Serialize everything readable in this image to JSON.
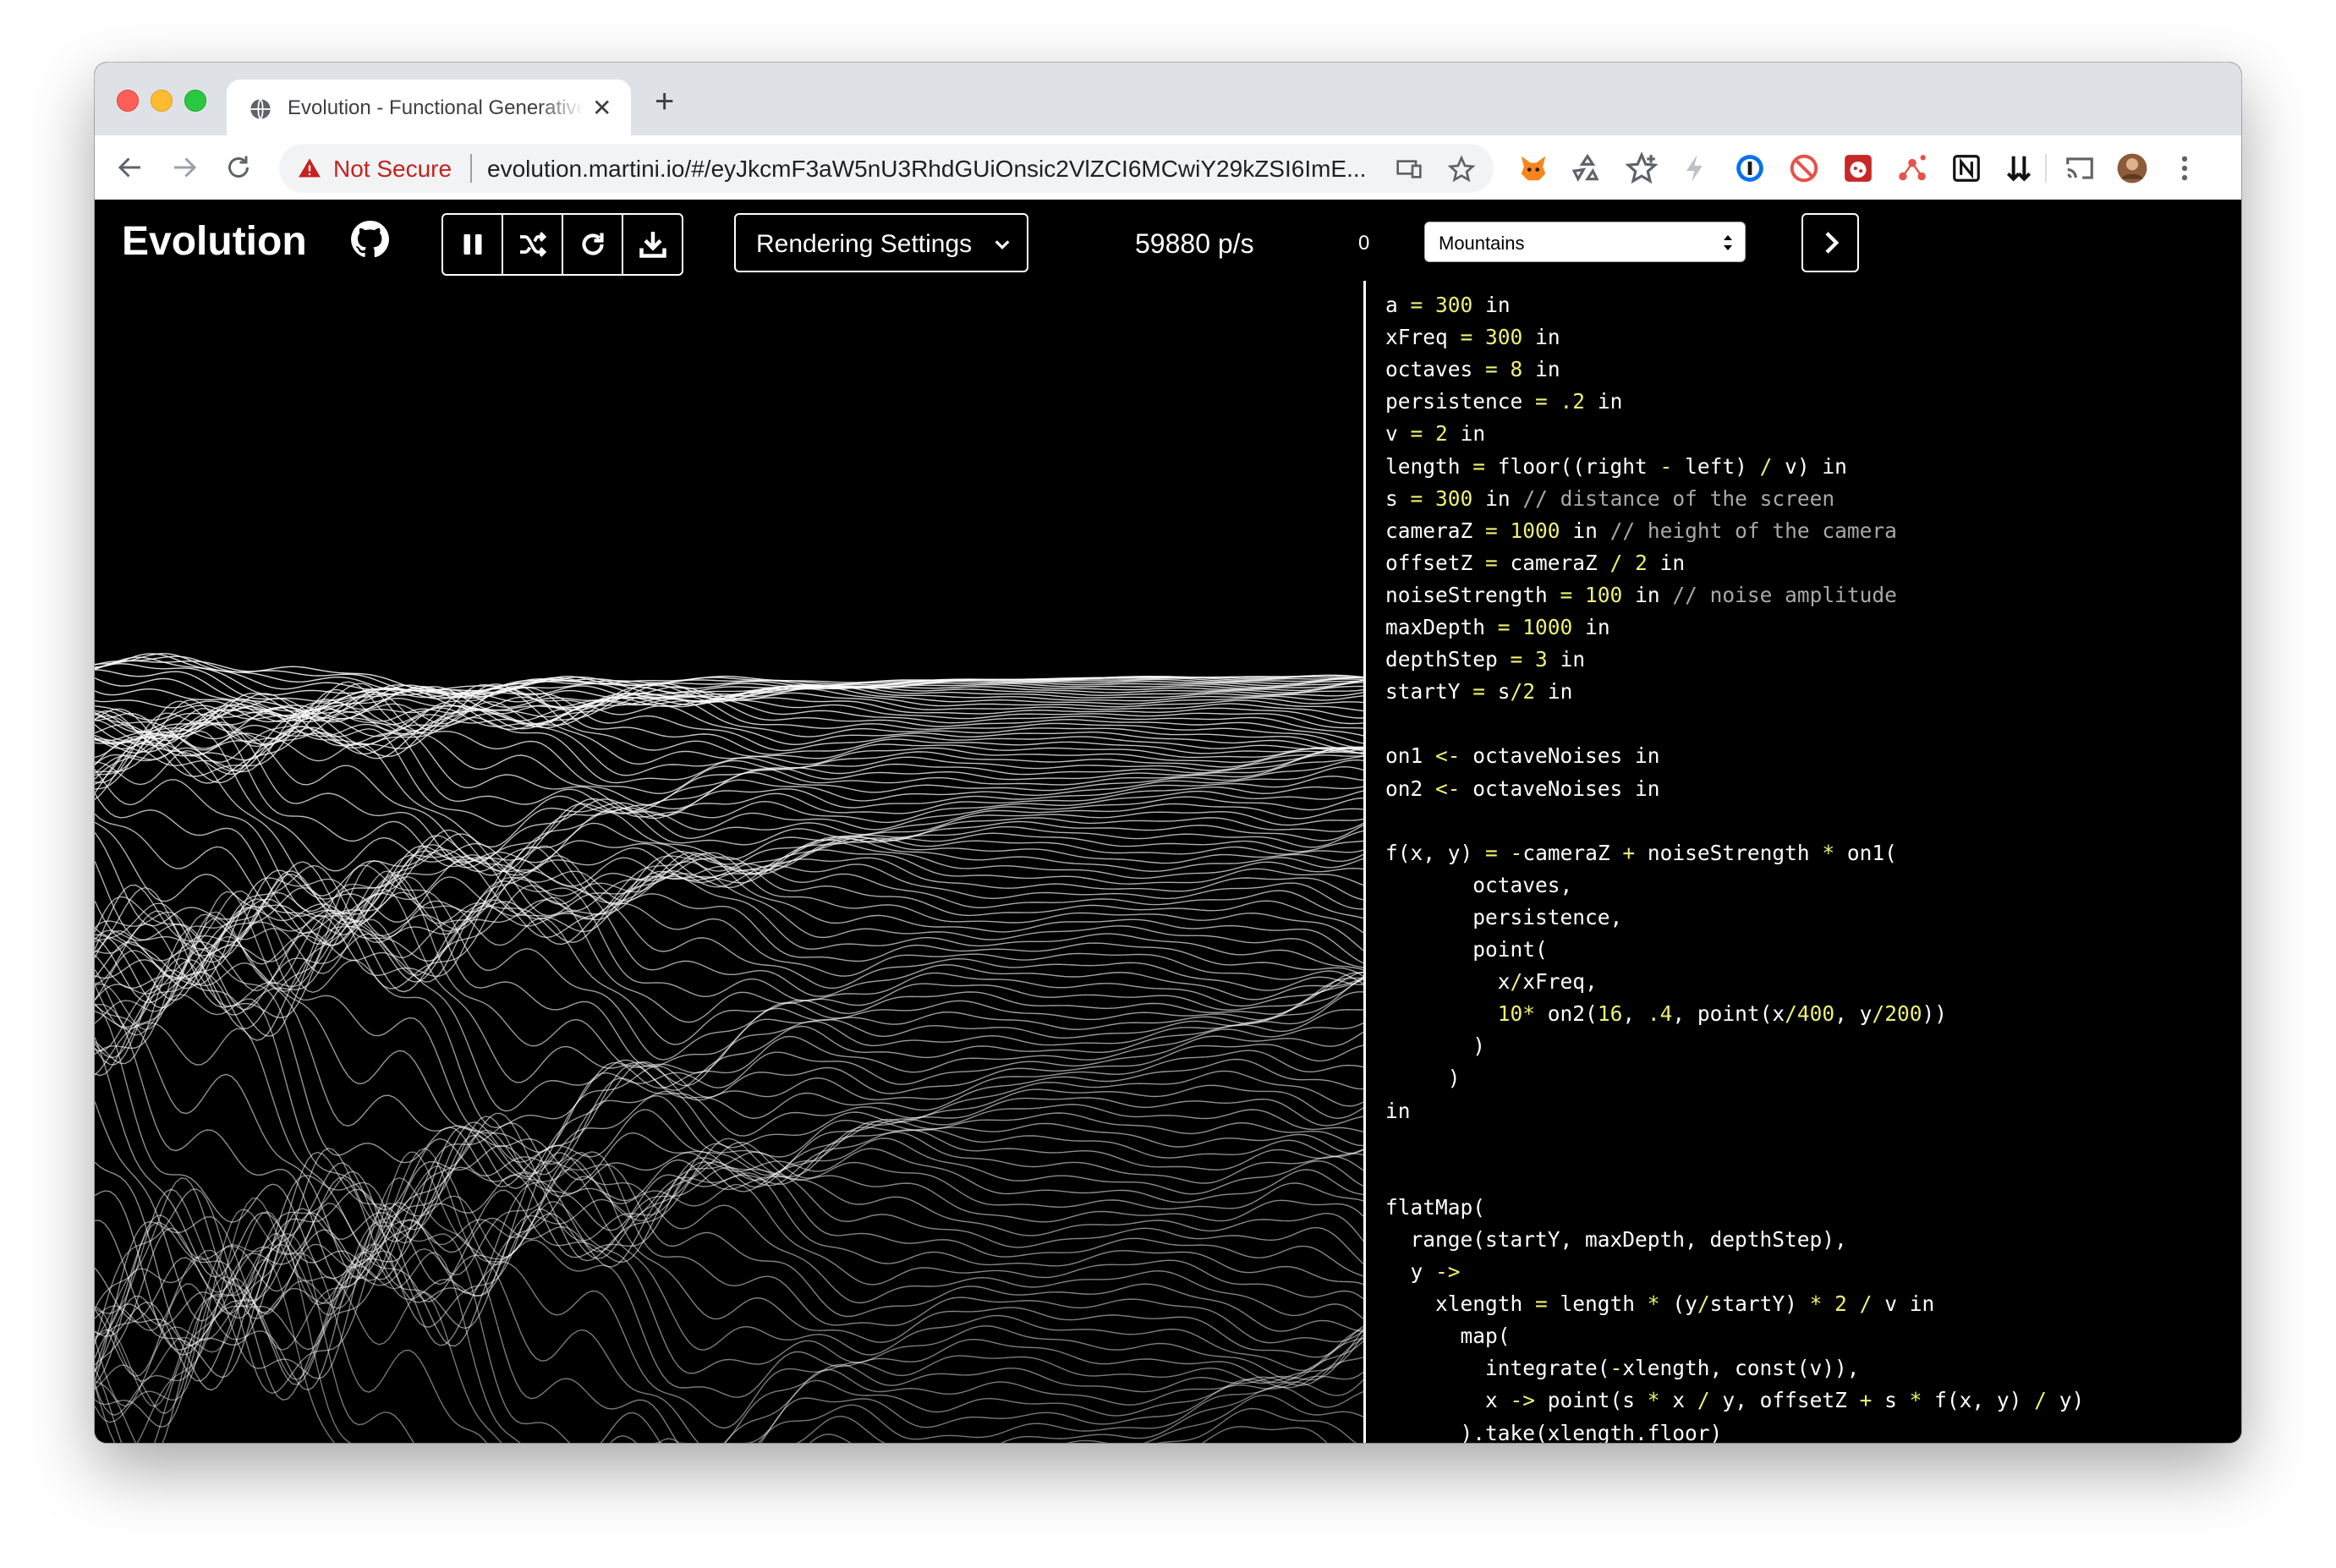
{
  "browser": {
    "tab_title": "Evolution - Functional Generative Art",
    "security_label": "Not Secure",
    "url": "evolution.martini.io/#/eyJkcmF3aW5nU3RhdGUiOnsic2VlZCI6MCwiY29kZSI6ImE..."
  },
  "app": {
    "title": "Evolution",
    "render_settings_label": "Rendering Settings",
    "rate": "59880 p/s",
    "counter": "0",
    "preset": "Mountains"
  },
  "editor": {
    "lines": [
      [
        [
          "a ",
          ""
        ],
        [
          "=",
          "y"
        ],
        [
          " ",
          ""
        ],
        [
          "300",
          "y"
        ],
        [
          " in",
          ""
        ]
      ],
      [
        [
          "xFreq ",
          ""
        ],
        [
          "=",
          "y"
        ],
        [
          " ",
          ""
        ],
        [
          "300",
          "y"
        ],
        [
          " in",
          ""
        ]
      ],
      [
        [
          "octaves ",
          ""
        ],
        [
          "=",
          "y"
        ],
        [
          " ",
          ""
        ],
        [
          "8",
          "y"
        ],
        [
          " in",
          ""
        ]
      ],
      [
        [
          "persistence ",
          ""
        ],
        [
          "=",
          "y"
        ],
        [
          " ",
          ""
        ],
        [
          ".2",
          "y"
        ],
        [
          " in",
          ""
        ]
      ],
      [
        [
          "v ",
          ""
        ],
        [
          "=",
          "y"
        ],
        [
          " ",
          ""
        ],
        [
          "2",
          "y"
        ],
        [
          " in",
          ""
        ]
      ],
      [
        [
          "length ",
          ""
        ],
        [
          "=",
          "y"
        ],
        [
          " floor((right ",
          ""
        ],
        [
          "-",
          "y"
        ],
        [
          " left) ",
          ""
        ],
        [
          "/",
          "y"
        ],
        [
          " v) in",
          ""
        ]
      ],
      [
        [
          "s ",
          ""
        ],
        [
          "=",
          "y"
        ],
        [
          " ",
          ""
        ],
        [
          "300",
          "y"
        ],
        [
          " in ",
          ""
        ],
        [
          "// distance of the screen",
          "c"
        ]
      ],
      [
        [
          "cameraZ ",
          ""
        ],
        [
          "=",
          "y"
        ],
        [
          " ",
          ""
        ],
        [
          "1000",
          "y"
        ],
        [
          " in ",
          ""
        ],
        [
          "// height of the camera",
          "c"
        ]
      ],
      [
        [
          "offsetZ ",
          ""
        ],
        [
          "=",
          "y"
        ],
        [
          " cameraZ ",
          ""
        ],
        [
          "/",
          "y"
        ],
        [
          " ",
          ""
        ],
        [
          "2",
          "y"
        ],
        [
          " in",
          ""
        ]
      ],
      [
        [
          "noiseStrength ",
          ""
        ],
        [
          "=",
          "y"
        ],
        [
          " ",
          ""
        ],
        [
          "100",
          "y"
        ],
        [
          " in ",
          ""
        ],
        [
          "// noise amplitude",
          "c"
        ]
      ],
      [
        [
          "maxDepth ",
          ""
        ],
        [
          "=",
          "y"
        ],
        [
          " ",
          ""
        ],
        [
          "1000",
          "y"
        ],
        [
          " in",
          ""
        ]
      ],
      [
        [
          "depthStep ",
          ""
        ],
        [
          "=",
          "y"
        ],
        [
          " ",
          ""
        ],
        [
          "3",
          "y"
        ],
        [
          " in",
          ""
        ]
      ],
      [
        [
          "startY ",
          ""
        ],
        [
          "=",
          "y"
        ],
        [
          " s",
          ""
        ],
        [
          "/",
          "y"
        ],
        [
          "2",
          "y"
        ],
        [
          " in",
          ""
        ]
      ],
      [],
      [
        [
          "on1 ",
          ""
        ],
        [
          "<-",
          "y"
        ],
        [
          " octaveNoises in",
          ""
        ]
      ],
      [
        [
          "on2 ",
          ""
        ],
        [
          "<-",
          "y"
        ],
        [
          " octaveNoises in",
          ""
        ]
      ],
      [],
      [
        [
          "f(x, y) ",
          ""
        ],
        [
          "=",
          "y"
        ],
        [
          " ",
          ""
        ],
        [
          "-",
          "y"
        ],
        [
          "cameraZ ",
          ""
        ],
        [
          "+",
          "y"
        ],
        [
          " noiseStrength ",
          ""
        ],
        [
          "*",
          "y"
        ],
        [
          " on1(",
          ""
        ]
      ],
      [
        [
          "       octaves,",
          ""
        ]
      ],
      [
        [
          "       persistence,",
          ""
        ]
      ],
      [
        [
          "       point(",
          ""
        ]
      ],
      [
        [
          "         x",
          ""
        ],
        [
          "/",
          "y"
        ],
        [
          "xFreq,",
          ""
        ]
      ],
      [
        [
          "         ",
          ""
        ],
        [
          "10",
          "y"
        ],
        [
          "*",
          "y"
        ],
        [
          " on2(",
          ""
        ],
        [
          "16",
          "y"
        ],
        [
          ", ",
          ""
        ],
        [
          ".4",
          "y"
        ],
        [
          ", point(x",
          ""
        ],
        [
          "/",
          "y"
        ],
        [
          "400",
          "y"
        ],
        [
          ", y",
          ""
        ],
        [
          "/",
          "y"
        ],
        [
          "200",
          "y"
        ],
        [
          "))",
          ""
        ]
      ],
      [
        [
          "       )",
          ""
        ]
      ],
      [
        [
          "     )",
          ""
        ]
      ],
      [
        [
          "in",
          ""
        ]
      ],
      [],
      [],
      [
        [
          "flatMap(",
          ""
        ]
      ],
      [
        [
          "  range(startY, maxDepth, depthStep),",
          ""
        ]
      ],
      [
        [
          "  y ",
          ""
        ],
        [
          "->",
          "y"
        ]
      ],
      [
        [
          "    xlength ",
          ""
        ],
        [
          "=",
          "y"
        ],
        [
          " length ",
          ""
        ],
        [
          "*",
          "y"
        ],
        [
          " (y",
          ""
        ],
        [
          "/",
          "y"
        ],
        [
          "startY) ",
          ""
        ],
        [
          "*",
          "y"
        ],
        [
          " ",
          ""
        ],
        [
          "2",
          "y"
        ],
        [
          " ",
          ""
        ],
        [
          "/",
          "y"
        ],
        [
          " v in",
          ""
        ]
      ],
      [
        [
          "      map(",
          ""
        ]
      ],
      [
        [
          "        integrate(",
          ""
        ],
        [
          "-",
          "y"
        ],
        [
          "xlength, const(v)),",
          ""
        ]
      ],
      [
        [
          "        x ",
          ""
        ],
        [
          "->",
          "y"
        ],
        [
          " point(s ",
          ""
        ],
        [
          "*",
          "y"
        ],
        [
          " x ",
          ""
        ],
        [
          "/",
          "y"
        ],
        [
          " y, offsetZ ",
          ""
        ],
        [
          "+",
          "y"
        ],
        [
          " s ",
          ""
        ],
        [
          "*",
          "y"
        ],
        [
          " f(x, y) ",
          ""
        ],
        [
          "/",
          "y"
        ],
        [
          " y)",
          ""
        ]
      ],
      [
        [
          "      ).take(xlength.floor)",
          ""
        ]
      ]
    ]
  },
  "colors": {
    "background": "#000000",
    "foreground": "#ffffff",
    "code_accent": "#f0f070",
    "code_comment": "#a8a8a8",
    "not_secure": "#c5221f"
  }
}
